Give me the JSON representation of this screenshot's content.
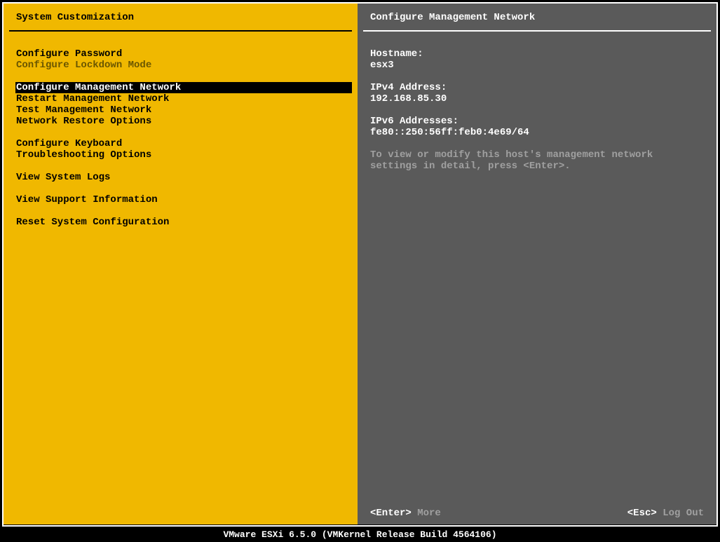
{
  "left": {
    "title": "System Customization",
    "menu": [
      {
        "label": "Configure Password",
        "type": "item"
      },
      {
        "label": "Configure Lockdown Mode",
        "type": "disabled"
      },
      {
        "type": "spacer"
      },
      {
        "label": "Configure Management Network",
        "type": "selected"
      },
      {
        "label": "Restart Management Network",
        "type": "item"
      },
      {
        "label": "Test Management Network",
        "type": "item"
      },
      {
        "label": "Network Restore Options",
        "type": "item"
      },
      {
        "type": "spacer"
      },
      {
        "label": "Configure Keyboard",
        "type": "item"
      },
      {
        "label": "Troubleshooting Options",
        "type": "item"
      },
      {
        "type": "spacer"
      },
      {
        "label": "View System Logs",
        "type": "item"
      },
      {
        "type": "spacer"
      },
      {
        "label": "View Support Information",
        "type": "item"
      },
      {
        "type": "spacer"
      },
      {
        "label": "Reset System Configuration",
        "type": "item"
      }
    ]
  },
  "right": {
    "title": "Configure Management Network",
    "hostname_label": "Hostname:",
    "hostname_value": "esx3",
    "ipv4_label": "IPv4 Address:",
    "ipv4_value": "192.168.85.30",
    "ipv6_label": "IPv6 Addresses:",
    "ipv6_value": "fe80::250:56ff:feb0:4e69/64",
    "hint": "To view or modify this host's management network settings in detail, press <Enter>."
  },
  "footer": {
    "enter_key": "<Enter>",
    "enter_action": "More",
    "esc_key": "<Esc>",
    "esc_action": "Log Out"
  },
  "status_bar": "VMware ESXi 6.5.0 (VMKernel Release Build 4564106)"
}
